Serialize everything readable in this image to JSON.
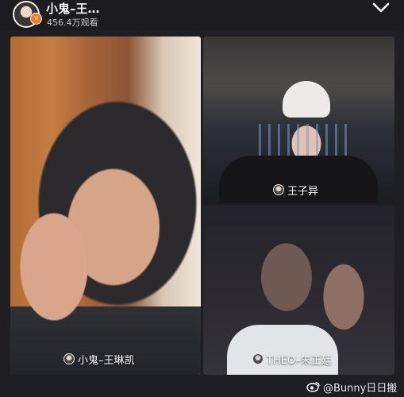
{
  "header": {
    "host_name": "小鬼–王…",
    "viewer_count": "456.4万观看",
    "verify_badge": "v",
    "collapse_icon": "chevron-down-icon"
  },
  "tiles": {
    "main": {
      "label": "小鬼–王琳凯"
    },
    "top_right": {
      "label": "王子异"
    },
    "bottom_right": {
      "label": "THEO–朱正廷"
    }
  },
  "watermark": {
    "text": "@Bunny日日搬",
    "icon": "weibo-icon"
  },
  "colors": {
    "background": "#1f1e22",
    "badge": "#f07e24",
    "text": "#ffffff"
  }
}
